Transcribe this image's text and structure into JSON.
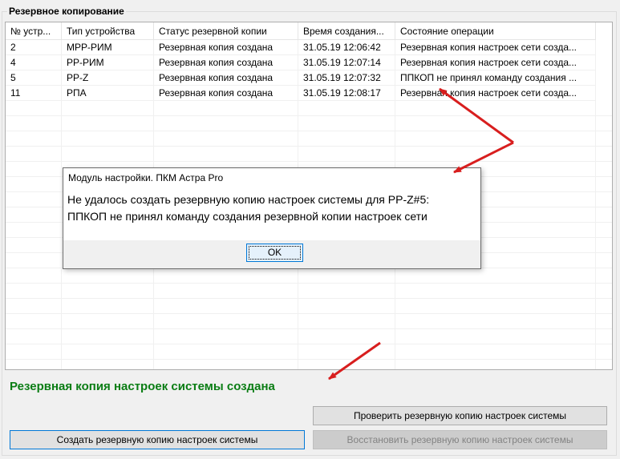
{
  "group_title": "Резервное копирование",
  "table": {
    "columns": [
      "№ устр...",
      "Тип устройства",
      "Статус резервной копии",
      "Время создания...",
      "Состояние операции"
    ],
    "rows": [
      [
        "2",
        "МРР-РИМ",
        "Резервная копия создана",
        "31.05.19 12:06:42",
        "Резервная копия настроек сети созда..."
      ],
      [
        "4",
        "РР-РИМ",
        "Резервная копия создана",
        "31.05.19 12:07:14",
        "Резервная копия настроек сети созда..."
      ],
      [
        "5",
        "РР-Z",
        "Резервная копия создана",
        "31.05.19 12:07:32",
        "ППКОП не принял команду создания ..."
      ],
      [
        "11",
        "РПА",
        "Резервная копия создана",
        "31.05.19 12:08:17",
        "Резервная копия настроек сети созда..."
      ]
    ]
  },
  "status_message": "Резервная копия настроек системы создана",
  "colors": {
    "status": "#0a7d14",
    "arrow": "#d81e1e",
    "focus": "#0078d7"
  },
  "buttons": {
    "verify": "Проверить резервную копию настроек системы",
    "create": "Создать резервную копию настроек системы",
    "restore": "Восстановить резервную копию настроек системы"
  },
  "dialog": {
    "title": "Модуль настройки. ПКМ Астра Pro",
    "line1": "Не удалось создать резервную копию настроек системы для РР-Z#5:",
    "line2": "ППКОП не принял команду создания резервной копии настроек сети",
    "ok_label": "OK"
  }
}
